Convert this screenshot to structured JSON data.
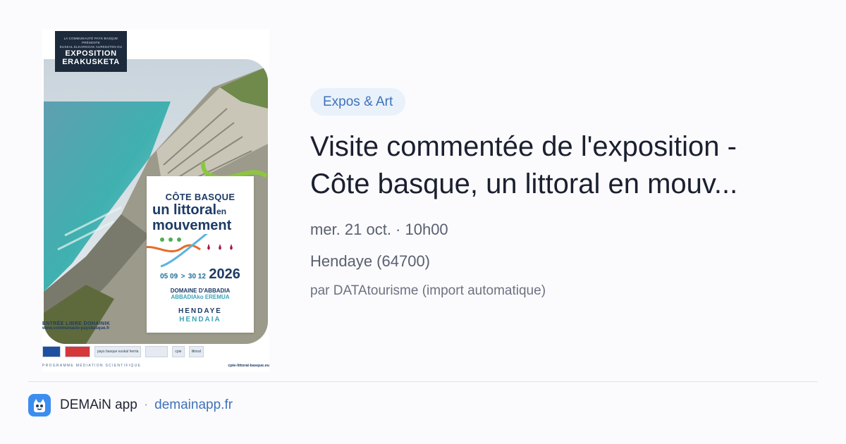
{
  "poster": {
    "header_line1": "LA COMMUNAUTÉ PAYS BASQUE PRÉSENTE",
    "header_line2": "EUSKAL ELKARGOAK AURKEZTEN DU",
    "header_line3": "EXPOSITION",
    "header_line4": "ERAKUSKETA",
    "card_line1": "CÔTE BASQUE",
    "card_line2a": "un littoral",
    "card_line2b": "en",
    "card_line3": "mouvement",
    "dates_start": "05 09",
    "dates_sep": ">",
    "dates_end": "30 12",
    "year": "2026",
    "domaine_fr": "DOMAINE D'ABBADIA",
    "domaine_eu": "ABBADIAko EREMUA",
    "city_fr": "HENDAYE",
    "city_eu": "HENDAIA",
    "entry": "ENTRÉE LIBRE DOHAINIK",
    "site": "www.communaute-paysbasque.fr",
    "programme": "PROGRAMME MÉDIATION SCIENTIFIQUE",
    "programme_url": "cpie-littoral-basque.eu",
    "logos": [
      "pays basque euskal herria",
      "cpie",
      "littoral"
    ]
  },
  "event": {
    "category": "Expos & Art",
    "title": "Visite commentée de l'exposition -\nCôte basque, un littoral en mouv...",
    "date": "mer. 21 oct. · 10h00",
    "location": "Hendaye (64700)",
    "organizer": "par DATAtourisme (import automatique)"
  },
  "footer": {
    "app_name": "DEMAiN app",
    "separator": "·",
    "link": "demainapp.fr"
  },
  "colors": {
    "category_bg": "#e9f1fb",
    "category_text": "#3f72b9",
    "link": "#3f72b9",
    "app_icon": "#3b8ef0"
  }
}
